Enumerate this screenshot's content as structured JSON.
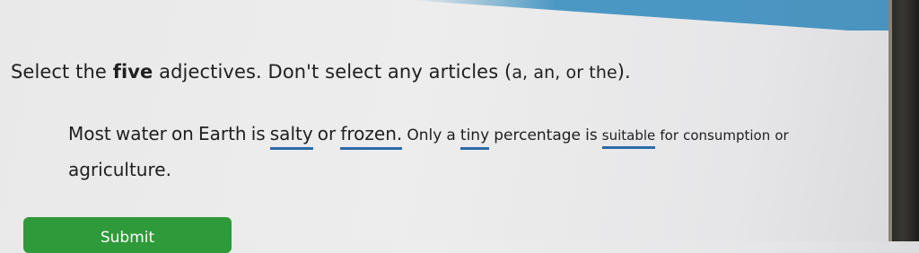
{
  "prompt": {
    "part1": "Select the ",
    "emphasis": "five",
    "part2": " adjectives. Don't select any articles (",
    "articles": "a, an, or the",
    "part3": ")."
  },
  "sentence": {
    "line1": [
      {
        "text": "Most"
      },
      {
        "text": "water"
      },
      {
        "text": "on"
      },
      {
        "text": "Earth"
      },
      {
        "text": "is"
      },
      {
        "text": "salty"
      },
      {
        "text": "or"
      },
      {
        "text": "frozen."
      },
      {
        "text": "Only"
      },
      {
        "text": "a"
      },
      {
        "text": "tiny"
      },
      {
        "text": "percentage"
      },
      {
        "text": "is"
      },
      {
        "text": "suitable"
      },
      {
        "text": "for"
      },
      {
        "text": "consumption"
      },
      {
        "text": "or"
      }
    ],
    "line2": [
      {
        "text": "agriculture."
      }
    ]
  },
  "submit": {
    "label": "Submit"
  },
  "colors": {
    "underline": "#2b6aa8",
    "submit": "#2e9a3a",
    "banner": "#4b98c4"
  }
}
